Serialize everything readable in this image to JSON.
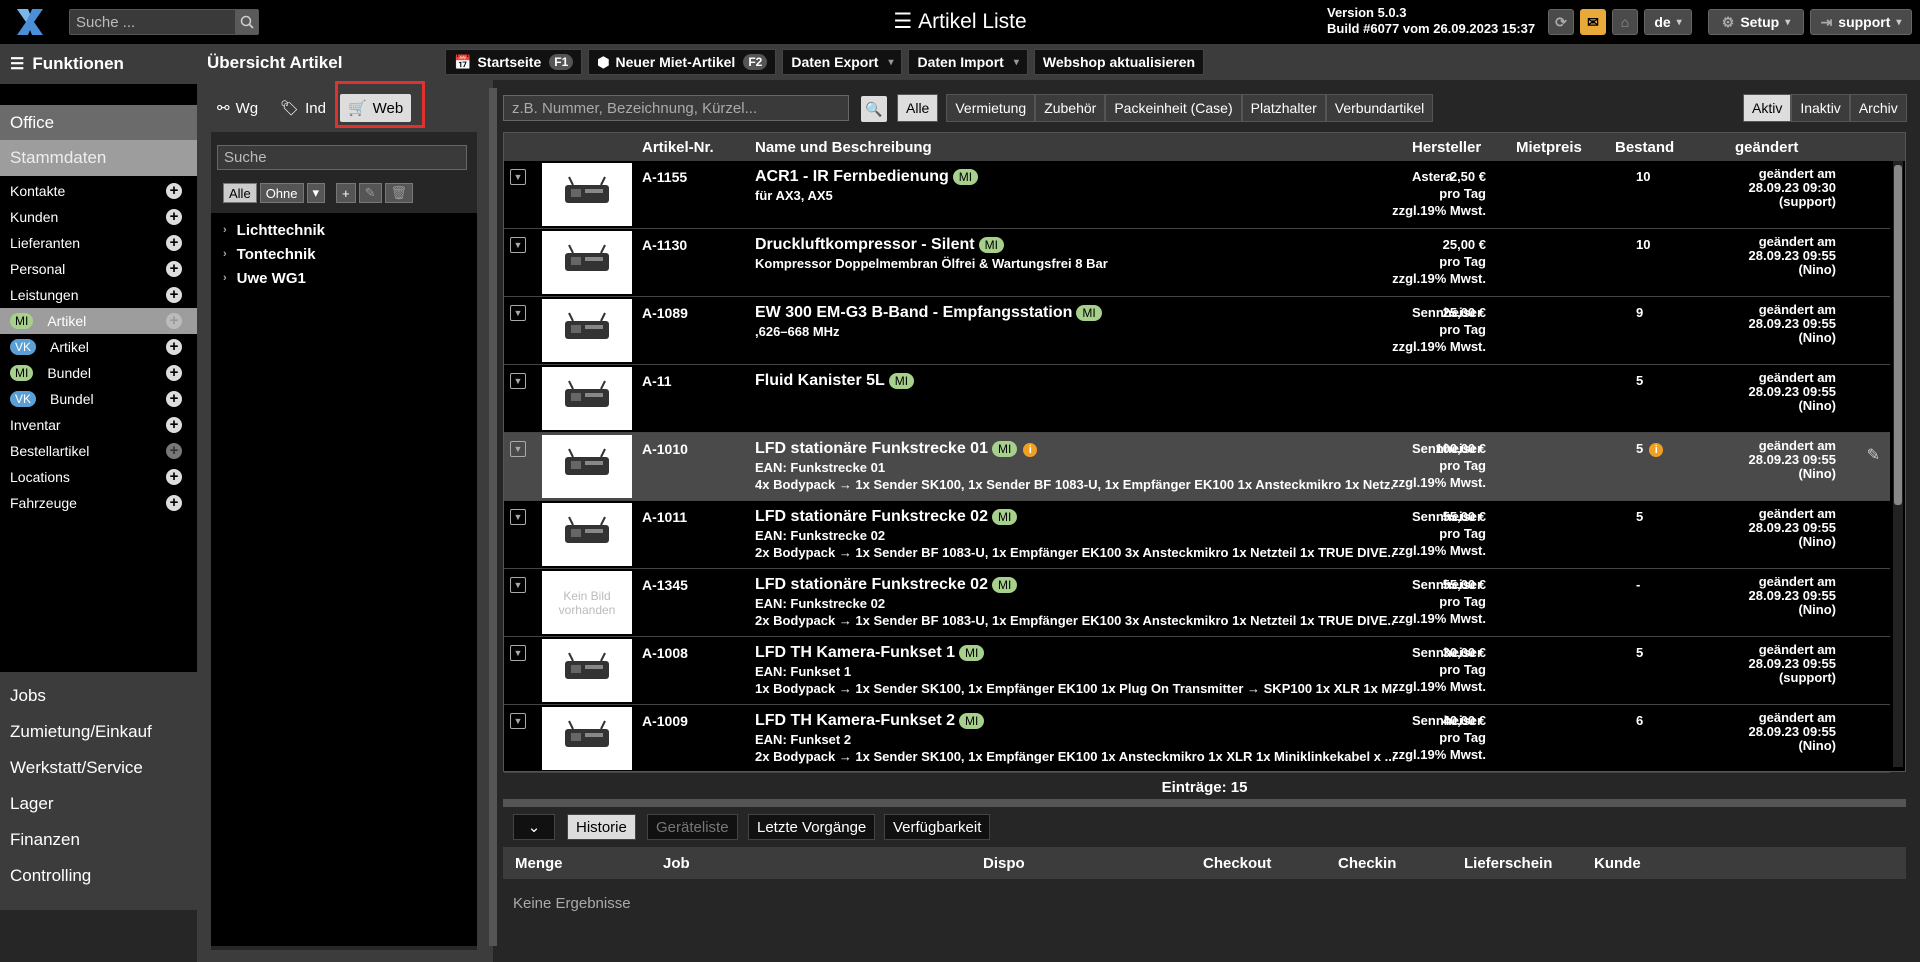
{
  "topbar": {
    "search_placeholder": "Suche ...",
    "title": "Artikel Liste",
    "version": "Version 5.0.3",
    "build": "Build #6077 vom 26.09.2023 15:37",
    "lang": "de",
    "setup": "Setup",
    "user": "support"
  },
  "sidebar": {
    "header": "Funktionen",
    "office": "Office",
    "stammdaten": "Stammdaten",
    "items": [
      {
        "label": "Kontakte"
      },
      {
        "label": "Kunden"
      },
      {
        "label": "Lieferanten"
      },
      {
        "label": "Personal"
      },
      {
        "label": "Leistungen"
      },
      {
        "badge": "MI",
        "label": "Artikel"
      },
      {
        "badge": "VK",
        "label": "Artikel"
      },
      {
        "badge": "MI",
        "label": "Bundel"
      },
      {
        "badge": "VK",
        "label": "Bundel"
      },
      {
        "label": "Inventar"
      },
      {
        "label": "Bestellartikel"
      },
      {
        "label": "Locations"
      },
      {
        "label": "Fahrzeuge"
      }
    ],
    "bottom": [
      "Jobs",
      "Zumietung/Einkauf",
      "Werkstatt/Service",
      "Lager",
      "Finanzen",
      "Controlling"
    ]
  },
  "mid": {
    "title": "Übersicht Artikel",
    "tabs": [
      "Wg",
      "Ind",
      "Web"
    ],
    "search_placeholder": "Suche",
    "filter_all": "Alle",
    "filter_none": "Ohne",
    "tree": [
      "Lichttechnik",
      "Tontechnik",
      "Uwe WG1"
    ]
  },
  "main": {
    "buttons": {
      "startseite": "Startseite",
      "startseite_key": "F1",
      "neu": "Neuer Miet-Artikel",
      "neu_key": "F2",
      "export": "Daten Export",
      "import": "Daten Import",
      "webshop": "Webshop aktualisieren"
    },
    "search_placeholder": "z.B. Nummer, Bezeichnung, Kürzel...",
    "filters": [
      "Alle",
      "Vermietung",
      "Zubehör",
      "Packeinheit (Case)",
      "Platzhalter",
      "Verbundartikel"
    ],
    "status": [
      "Aktiv",
      "Inaktiv",
      "Archiv"
    ],
    "columns": {
      "num": "Artikel-Nr.",
      "name": "Name und Beschreibung",
      "mfr": "Hersteller",
      "price": "Mietpreis",
      "stock": "Bestand",
      "changed": "geändert"
    },
    "rows": [
      {
        "num": "A-1155",
        "name": "ACR1 - IR Fernbedienung",
        "badge": "MI",
        "desc1": "für AX3, AX5",
        "desc2": "",
        "mfr": "Astera",
        "price": "2,50 €",
        "stock": "10",
        "date": "28.09.23 09:30",
        "user": "(support)"
      },
      {
        "num": "A-1130",
        "name": "Druckluftkompressor - Silent",
        "badge": "MI",
        "desc1": "Kompressor Doppelmembran Ölfrei & Wartungsfrei 8 Bar",
        "desc2": "",
        "mfr": "",
        "price": "25,00 €",
        "stock": "10",
        "date": "28.09.23 09:55",
        "user": "(Nino)"
      },
      {
        "num": "A-1089",
        "name": "EW 300 EM-G3 B-Band - Empfangsstation",
        "badge": "MI",
        "desc1": ",626–668 MHz",
        "desc2": "",
        "mfr": "Sennheiser",
        "price": "25,00 €",
        "stock": "9",
        "date": "28.09.23 09:55",
        "user": "(Nino)"
      },
      {
        "num": "A-11",
        "name": "Fluid Kanister 5L",
        "badge": "MI",
        "desc1": "",
        "desc2": "",
        "mfr": "",
        "price": "",
        "stock": "5",
        "date": "28.09.23 09:55",
        "user": "(Nino)"
      },
      {
        "num": "A-1010",
        "name": "LFD stationäre Funkstrecke 01",
        "badge": "MI",
        "desc1": "EAN: Funkstrecke 01",
        "desc2": "4x Bodypack → 1x Sender SK100, 1x Sender BF 1083-U, 1x Empfänger EK100 1x Ansteckmikro 1x Netz...",
        "mfr": "Sennheiser",
        "price": "100,00 €",
        "stock": "5",
        "date": "28.09.23 09:55",
        "user": "(Nino)"
      },
      {
        "num": "A-1011",
        "name": "LFD stationäre Funkstrecke 02",
        "badge": "MI",
        "desc1": "EAN: Funkstrecke 02",
        "desc2": "2x Bodypack → 1x Sender BF 1083-U, 1x Empfänger EK100 3x Ansteckmikro 1x Netzteil 1x TRUE DIVE...",
        "mfr": "Sennheiser",
        "price": "55,00 €",
        "stock": "5",
        "date": "28.09.23 09:55",
        "user": "(Nino)"
      },
      {
        "num": "A-1345",
        "name": "LFD stationäre Funkstrecke 02",
        "badge": "MI",
        "desc1": "EAN: Funkstrecke 02",
        "desc2": "2x Bodypack → 1x Sender BF 1083-U, 1x Empfänger EK100 3x Ansteckmikro 1x Netzteil 1x TRUE DIVE...",
        "mfr": "Sennheiser",
        "price": "55,00 €",
        "stock": "-",
        "date": "28.09.23 09:55",
        "user": "(Nino)"
      },
      {
        "num": "A-1008",
        "name": "LFD TH Kamera-Funkset 1",
        "badge": "MI",
        "desc1": "EAN: Funkset 1",
        "desc2": "1x Bodypack → 1x Sender SK100, 1x Empfänger EK100 1x Plug On Transmitter → SKP100 1x XLR 1x M...",
        "mfr": "Sennheiser",
        "price": "30,00 €",
        "stock": "5",
        "date": "28.09.23 09:55",
        "user": "(support)"
      },
      {
        "num": "A-1009",
        "name": "LFD TH Kamera-Funkset 2",
        "badge": "MI",
        "desc1": "EAN: Funkset 2",
        "desc2": "2x Bodypack → 1x Sender SK100, 1x Empfänger EK100 1x Ansteckmikro 1x XLR 1x Miniklinkekabel x ...",
        "mfr": "Sennheiser",
        "price": "40,00 €",
        "stock": "6",
        "date": "28.09.23 09:55",
        "user": "(Nino)"
      }
    ],
    "per_day": "pro Tag",
    "vat": "zzgl.19% Mwst.",
    "changed_label": "geändert am",
    "no_image": "Kein Bild vorhanden",
    "entries": "Einträge: 15"
  },
  "bottom": {
    "tabs": [
      "Historie",
      "Geräteliste",
      "Letzte Vorgänge",
      "Verfügbarkeit"
    ],
    "columns": [
      "Menge",
      "Job",
      "Dispo",
      "Checkout",
      "Checkin",
      "Lieferschein",
      "Kunde"
    ],
    "empty": "Keine Ergebnisse"
  }
}
